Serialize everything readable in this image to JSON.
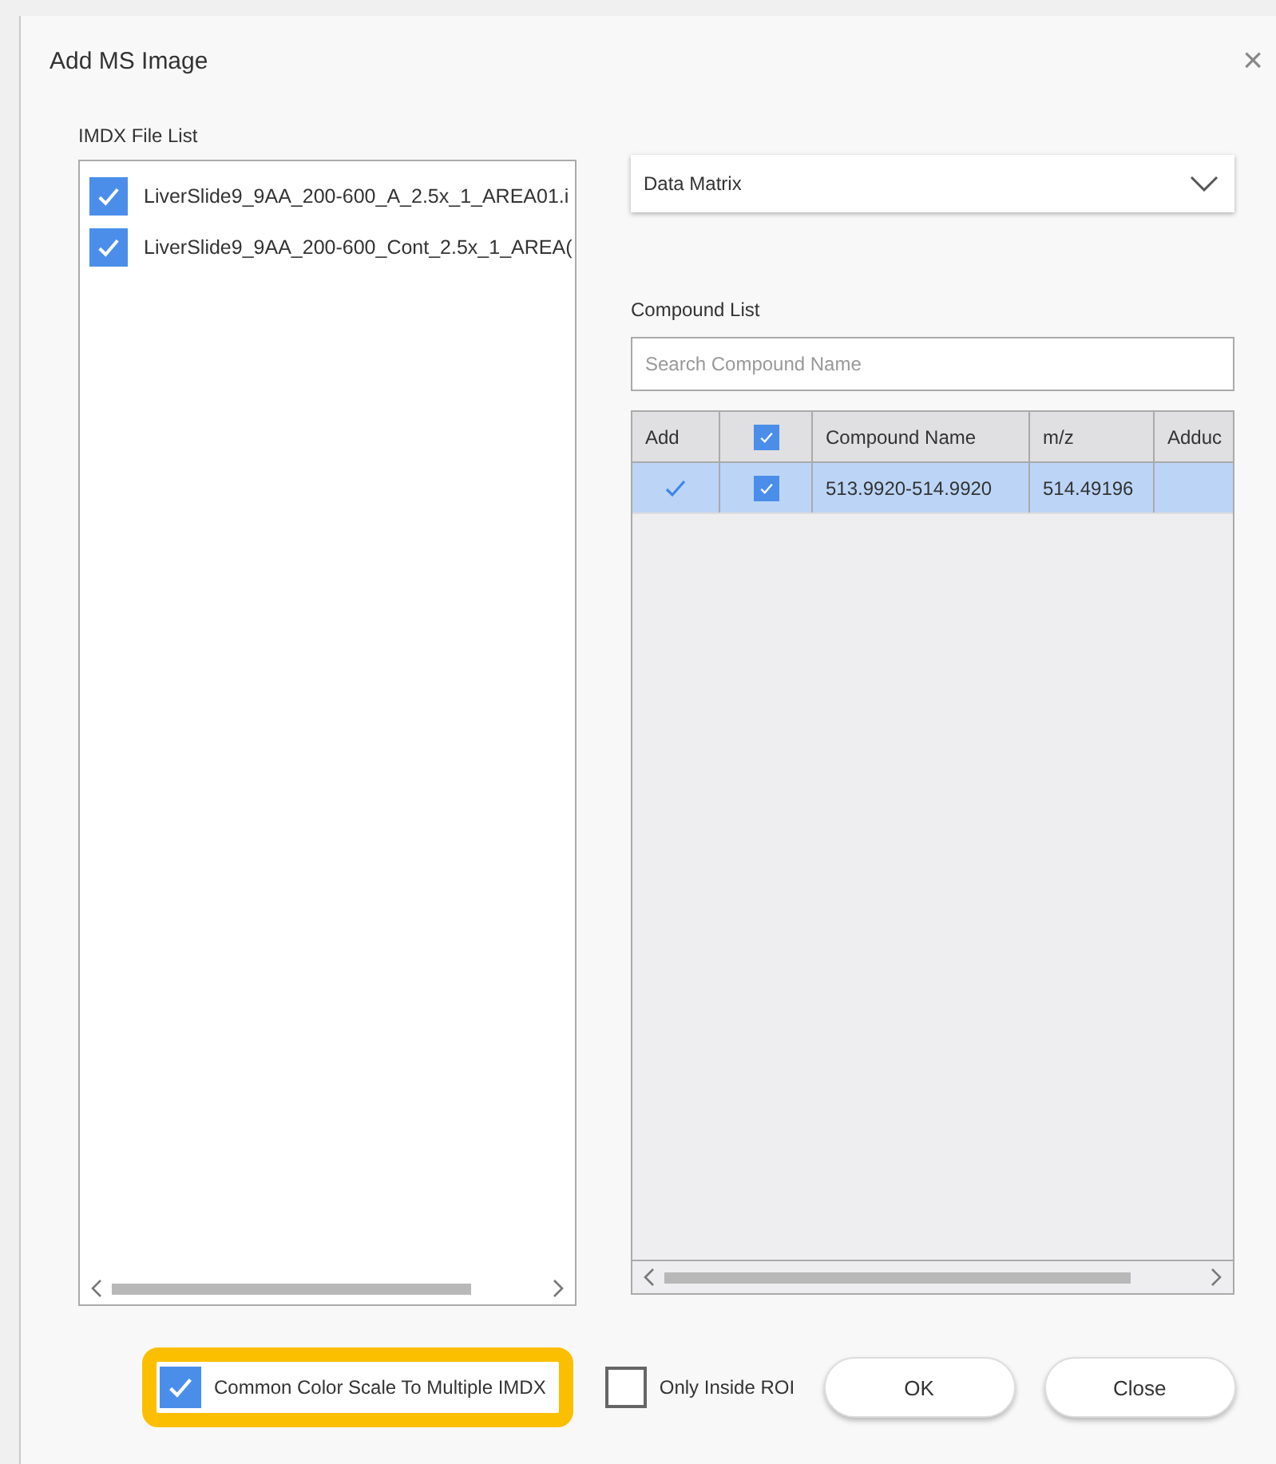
{
  "window": {
    "title": "Add MS Image",
    "close": "×"
  },
  "file_list": {
    "label": "IMDX File List",
    "items": [
      {
        "name": "LiverSlide9_9AA_200-600_A_2.5x_1_AREA01.i",
        "checked": true
      },
      {
        "name": "LiverSlide9_9AA_200-600_Cont_2.5x_1_AREA(",
        "checked": true
      }
    ]
  },
  "matrix_dropdown": {
    "value": "Data Matrix"
  },
  "compound_list": {
    "label": "Compound List",
    "search": {
      "placeholder": "Search Compound Name"
    },
    "table": {
      "columns": [
        {
          "kind": "text",
          "label": "Add"
        },
        {
          "kind": "checkbox",
          "checked": true
        },
        {
          "kind": "text",
          "label": "Compound Name"
        },
        {
          "kind": "text",
          "label": "m/z"
        },
        {
          "kind": "text",
          "label": "Adduc"
        }
      ],
      "rows": [
        {
          "selected": true,
          "add": true,
          "checked": true,
          "compound_name": "513.9920-514.9920",
          "mz": "514.49196",
          "column_5": ""
        }
      ]
    }
  },
  "options": [
    {
      "label": "Common Color Scale To Multiple IMDX",
      "checked": true,
      "highlighted": true
    },
    {
      "label": "Only Inside ROI",
      "checked": false,
      "highlighted": false
    }
  ],
  "buttons": [
    "OK",
    "Close"
  ]
}
